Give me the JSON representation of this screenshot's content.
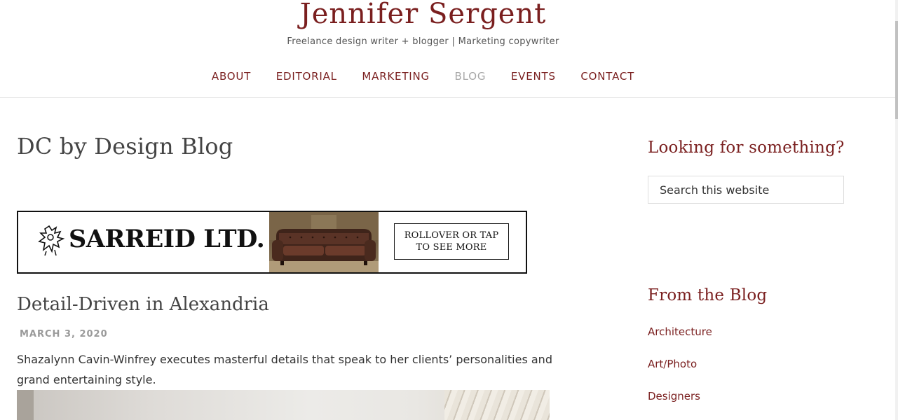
{
  "header": {
    "site_title": "Jennifer Sergent",
    "tagline": "Freelance design writer + blogger | Marketing copywriter"
  },
  "nav": {
    "items": [
      {
        "label": "ABOUT"
      },
      {
        "label": "EDITORIAL"
      },
      {
        "label": "MARKETING"
      },
      {
        "label": "BLOG",
        "current": true
      },
      {
        "label": "EVENTS"
      },
      {
        "label": "CONTACT"
      }
    ]
  },
  "main": {
    "page_title": "DC by Design Blog",
    "ad": {
      "brand": "SARREID LTD.",
      "cta_line1": "ROLLOVER OR TAP",
      "cta_line2": "TO SEE MORE"
    },
    "post": {
      "title": "Detail-Driven in Alexandria",
      "date": "MARCH 3, 2020",
      "excerpt": "Shazalynn Cavin-Winfrey executes masterful details that speak to her clients’ personalities and grand entertaining style."
    }
  },
  "sidebar": {
    "search_title": "Looking for something?",
    "search_placeholder": "Search this website",
    "blog_title": "From the Blog",
    "categories": [
      {
        "label": "Architecture"
      },
      {
        "label": "Art/Photo"
      },
      {
        "label": "Designers"
      }
    ]
  },
  "colors": {
    "accent": "#7a1f1f",
    "nav_current": "#a7a7a7",
    "heading_text": "#444444"
  }
}
